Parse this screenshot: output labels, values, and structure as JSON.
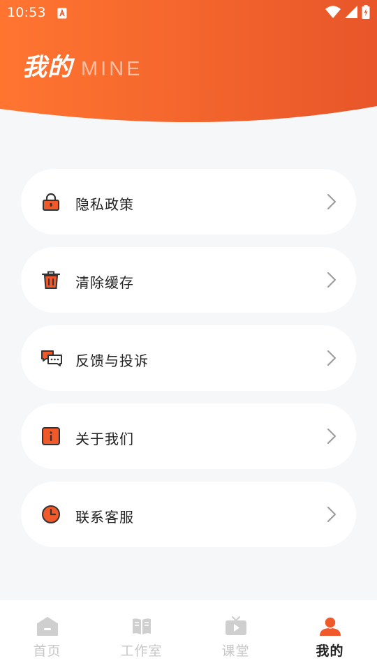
{
  "colors": {
    "accent": "#f0592a",
    "header_gradient_start": "#ff7530",
    "header_gradient_end": "#e8562a",
    "background": "#f6f7f9",
    "inactive_tab": "#c7c7c7"
  },
  "status_bar": {
    "time": "10:53",
    "icons": [
      "app-notification-icon",
      "wifi-icon",
      "cell-signal-icon",
      "battery-charging-icon"
    ]
  },
  "header": {
    "title": "我的",
    "subtitle": "MINE"
  },
  "menu": {
    "items": [
      {
        "label": "隐私政策",
        "icon": "lock-icon"
      },
      {
        "label": "清除缓存",
        "icon": "trash-icon"
      },
      {
        "label": "反馈与投诉",
        "icon": "chat-bubbles-icon"
      },
      {
        "label": "关于我们",
        "icon": "info-icon"
      },
      {
        "label": "联系客服",
        "icon": "clock-icon"
      }
    ]
  },
  "tabbar": {
    "tabs": [
      {
        "label": "首页",
        "icon": "home-icon",
        "active": false
      },
      {
        "label": "工作室",
        "icon": "book-icon",
        "active": false
      },
      {
        "label": "课堂",
        "icon": "tv-play-icon",
        "active": false
      },
      {
        "label": "我的",
        "icon": "user-icon",
        "active": true
      }
    ]
  }
}
